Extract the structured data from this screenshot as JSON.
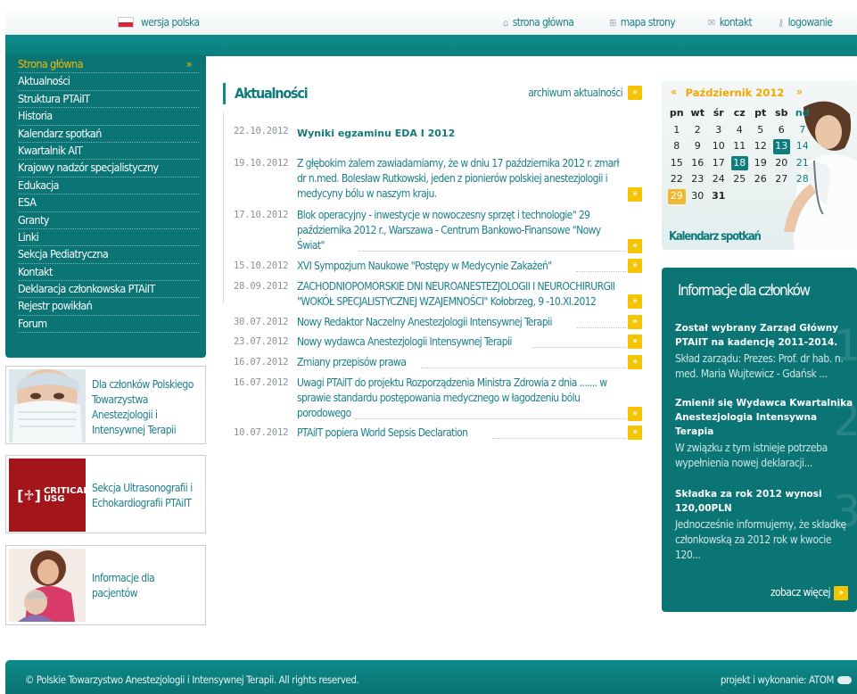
{
  "topbar": {
    "language": "wersja polska",
    "links": [
      {
        "label": "strona główna",
        "icon": "home-icon"
      },
      {
        "label": "mapa strony",
        "icon": "sitemap-icon"
      },
      {
        "label": "kontakt",
        "icon": "envelope-icon"
      },
      {
        "label": "logowanie",
        "icon": "key-icon"
      }
    ]
  },
  "nav": {
    "items": [
      "Strona główna",
      "Aktualności",
      "Struktura PTAiIT",
      "Historia",
      "Kalendarz spotkań",
      "Kwartalnik AIT",
      "Krajowy nadzór specjalistyczny",
      "Edukacja",
      "ESA",
      "Granty",
      "Linki",
      "Sekcja Pediatryczna",
      "Kontakt",
      "Deklaracja członkowska PTAiIT",
      "Rejestr powikłań",
      "Forum"
    ],
    "active": "Strona główna"
  },
  "promos": [
    {
      "text": "Dla członków Polskiego Towarzystwa Anestezjologii i Intensywnej Terapii",
      "image": "masked-doctor-image"
    },
    {
      "text": "Sekcja Ultrasonografii i Echokardiografii PTAiIT",
      "image": "critical-usg-logo",
      "logo_text": "CRITICAL USG"
    },
    {
      "text": "Informacje dla pacjentów",
      "image": "patients-image"
    }
  ],
  "news": {
    "title": "Aktualności",
    "archive": "archiwum aktualności",
    "items": [
      {
        "date": "22.10.2012",
        "title": "Wyniki egzaminu EDA I 2012"
      },
      {
        "date": "19.10.2012",
        "title": "Z głębokim żalem zawiadamiamy, że w dniu 17 października 2012 r. zmarł dr n.med. Bolesław Rutkowski, jeden z pionierów polskiej anestezjologii i medycyny bólu w naszym kraju."
      },
      {
        "date": "17.10.2012",
        "title": "Blok operacyjny - inwestycje w nowoczesny sprzęt i technologie\" 29 października 2012 r., Warszawa - Centrum Bankowo-Finansowe \"Nowy Świat\""
      },
      {
        "date": "15.10.2012",
        "title": "XVI Sympozjum Naukowe \"Postępy w Medycynie Zakażeń\""
      },
      {
        "date": "28.09.2012",
        "title": "ZACHODNIOPOMORSKIE DNI NEUROANESTEZJOLOGII I NEUROCHIRURGII \"WOKÓŁ SPECJALISTYCZNEJ WZAJEMNOŚCI\" Kołobrzeg, 9 -10.XI.2012"
      },
      {
        "date": "30.07.2012",
        "title": "Nowy Redaktor Naczelny Anestezjologii Intensywnej Terapii"
      },
      {
        "date": "23.07.2012",
        "title": "Nowy wydawca Anestezjologii Intensywnej Terapii"
      },
      {
        "date": "16.07.2012",
        "title": "Zmiany przepisów prawa"
      },
      {
        "date": "16.07.2012",
        "title": "Uwagi PTAiIT do projektu Rozporządzenia Ministra Zdrowia z dnia ....... w sprawie standardu postępowania medycznego w łagodzeniu bólu porodowego"
      },
      {
        "date": "10.07.2012",
        "title": "PTAiIT popiera World Sepsis Declaration"
      }
    ]
  },
  "calendar": {
    "prev": "«",
    "next": "»",
    "month": "Październik 2012",
    "weekdays": [
      "pn",
      "wt",
      "śr",
      "cz",
      "pt",
      "sb",
      "nd"
    ],
    "weeks": [
      [
        "1",
        "2",
        "3",
        "4",
        "5",
        "6",
        "7"
      ],
      [
        "8",
        "9",
        "10",
        "11",
        "12",
        "13",
        "14"
      ],
      [
        "15",
        "16",
        "17",
        "18",
        "19",
        "20",
        "21"
      ],
      [
        "22",
        "23",
        "24",
        "25",
        "26",
        "27",
        "28"
      ],
      [
        "29",
        "30",
        "31",
        "",
        "",
        "",
        ""
      ]
    ],
    "highlighted": [
      "13",
      "18"
    ],
    "today": "29",
    "label": "Kalendarz spotkań"
  },
  "member_info": {
    "title": "Informacje dla członków",
    "items": [
      {
        "num": "1",
        "title": "Został wybrany Zarząd Główny PTAiIT na kadencję 2011-2014.",
        "desc": "Skład zarządu: Prezes: Prof. dr hab. n. med. Maria Wujtewicz - Gdańsk ..."
      },
      {
        "num": "2",
        "title": "Zmienił się Wydawca Kwartalnika Anestezjologia Intensywna Terapia",
        "desc": "W związku z tym istnieje potrzeba wypełnienia nowej deklaracji..."
      },
      {
        "num": "3",
        "title": "Składka za rok 2012 wynosi 120,00PLN",
        "desc": "Jednocześnie informujemy, że składkę członkowską za 2012 rok w kwocie 120..."
      }
    ],
    "more": "zobacz więcej"
  },
  "footer": {
    "copyright": "© Polskie Towarzystwo Anestezjologii i Intensywnej Terapii. All rights reserved.",
    "credit": "projekt i wykonanie: ATOM"
  },
  "colors": {
    "teal": "#0b7474",
    "link": "#1b7f8a",
    "accent": "#f5c400"
  }
}
